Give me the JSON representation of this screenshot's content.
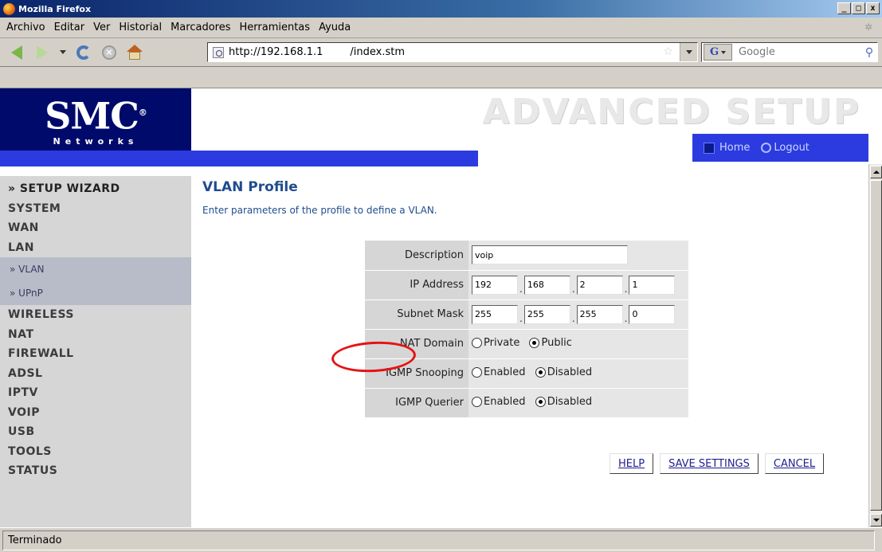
{
  "window": {
    "title": "Mozilla Firefox"
  },
  "menubar": {
    "items": [
      "Archivo",
      "Editar",
      "Ver",
      "Historial",
      "Marcadores",
      "Herramientas",
      "Ayuda"
    ]
  },
  "navbar": {
    "url_part1": "http://192.168.1.1",
    "url_part2": "/index.stm",
    "search_placeholder": "Google",
    "search_engine_icon": "G"
  },
  "banner": {
    "logo_text": "SMC",
    "logo_sub": "Networks",
    "section_title": "ADVANCED SETUP",
    "home_label": "Home",
    "logout_label": "Logout"
  },
  "sidebar": {
    "wizard": "» SETUP WIZARD",
    "items_top": [
      "SYSTEM",
      "WAN",
      "LAN"
    ],
    "subitems": [
      "» VLAN",
      "» UPnP"
    ],
    "items_bottom": [
      "WIRELESS",
      "NAT",
      "FIREWALL",
      "ADSL",
      "IPTV",
      "VOIP",
      "USB",
      "TOOLS",
      "STATUS"
    ]
  },
  "content": {
    "title": "VLAN Profile",
    "description": "Enter parameters of the profile to define a VLAN.",
    "form": {
      "description_label": "Description",
      "description_value": "voip",
      "ip_label": "IP Address",
      "ip": [
        "192",
        "168",
        "2",
        "1"
      ],
      "mask_label": "Subnet Mask",
      "mask": [
        "255",
        "255",
        "255",
        "0"
      ],
      "nat_label": "NAT Domain",
      "nat_private": "Private",
      "nat_public": "Public",
      "nat_selected": "Public",
      "igmp_snoop_label": "IGMP Snooping",
      "igmp_snoop_enabled": "Enabled",
      "igmp_snoop_disabled": "Disabled",
      "igmp_snoop_selected": "Disabled",
      "igmp_querier_label": "IGMP Querier",
      "igmp_querier_enabled": "Enabled",
      "igmp_querier_disabled": "Disabled",
      "igmp_querier_selected": "Disabled"
    },
    "buttons": {
      "help": "HELP",
      "save": "SAVE SETTINGS",
      "cancel": "CANCEL"
    }
  },
  "status": {
    "text": "Terminado"
  },
  "colors": {
    "brand_navy": "#000a6b",
    "accent_blue": "#2b3be0",
    "title_blue": "#1f4c8f",
    "annotation_red": "#e41414"
  }
}
